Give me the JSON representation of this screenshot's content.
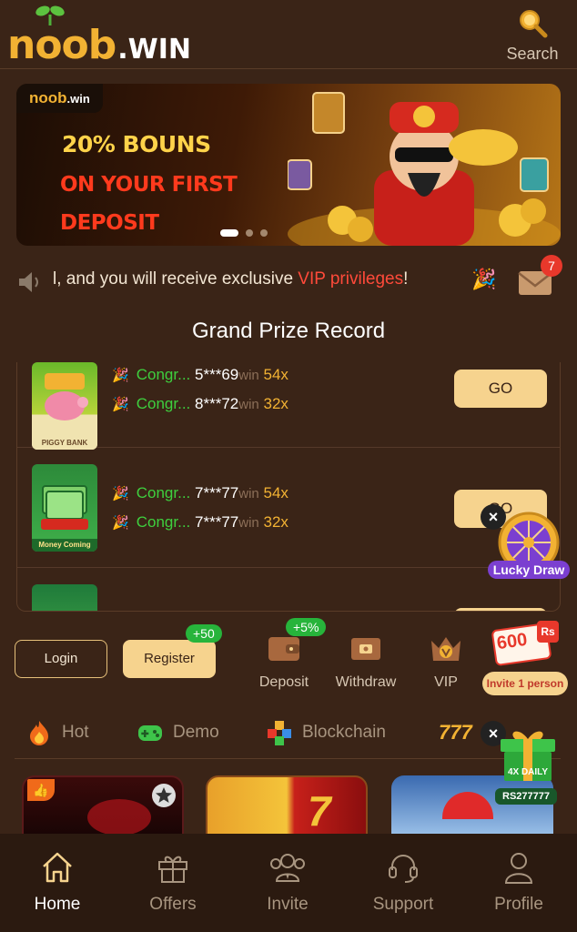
{
  "brand": {
    "logo_main": "noob",
    "logo_suffix": ".WIN"
  },
  "search": {
    "label": "Search"
  },
  "banner": {
    "brand_main": "noob",
    "brand_suffix": ".win",
    "line1": "20% BOUNS",
    "line2": "ON YOUR FIRST",
    "line3": "DEPOSIT",
    "slides": 3,
    "active_slide": 0
  },
  "marquee": {
    "text_before": "l, and you will receive exclusive ",
    "highlight": "VIP privileges",
    "text_after": "!",
    "mail_count": "7"
  },
  "prize_record": {
    "title": "Grand Prize Record",
    "rows": [
      {
        "game": "PIGGY BANK",
        "entries": [
          {
            "congrats": "Congr...",
            "user": "5***69",
            "win": "win",
            "multiplier": "54x"
          },
          {
            "congrats": "Congr...",
            "user": "8***72",
            "win": "win",
            "multiplier": "32x"
          }
        ],
        "button": "GO"
      },
      {
        "game": "Money Coming",
        "entries": [
          {
            "congrats": "Congr...",
            "user": "7***77",
            "win": "win",
            "multiplier": "54x"
          },
          {
            "congrats": "Congr...",
            "user": "7***77",
            "win": "win",
            "multiplier": "32x"
          }
        ],
        "button": "GO"
      }
    ]
  },
  "auth": {
    "login": "Login",
    "register": "Register",
    "register_bonus": "+50"
  },
  "actions": {
    "deposit": "Deposit",
    "deposit_bonus": "+5%",
    "withdraw": "Withdraw",
    "vip": "VIP"
  },
  "tabs": [
    {
      "label": "Hot",
      "icon": "fire-icon"
    },
    {
      "label": "Demo",
      "icon": "gamepad-icon"
    },
    {
      "label": "Blockchain",
      "icon": "cubes-icon"
    }
  ],
  "floating": {
    "lucky_draw": "Lucky Draw",
    "invite_amount": "600",
    "invite_label": "Invite 1 person",
    "daily_label": "4X DAILY",
    "daily_amount": "RS277777"
  },
  "bottom_nav": [
    {
      "label": "Home",
      "icon": "home-icon",
      "active": true
    },
    {
      "label": "Offers",
      "icon": "gift-icon",
      "active": false
    },
    {
      "label": "Invite",
      "icon": "users-icon",
      "active": false
    },
    {
      "label": "Support",
      "icon": "headset-icon",
      "active": false
    },
    {
      "label": "Profile",
      "icon": "user-icon",
      "active": false
    }
  ],
  "colors": {
    "background": "#3a2417",
    "accent_gold": "#f6d38e",
    "brand_orange": "#f2b233",
    "highlight_red": "#ff4a3a",
    "win_green": "#3ecf3e",
    "badge_green": "#27b43b",
    "nav_bg": "#2b1a10"
  }
}
